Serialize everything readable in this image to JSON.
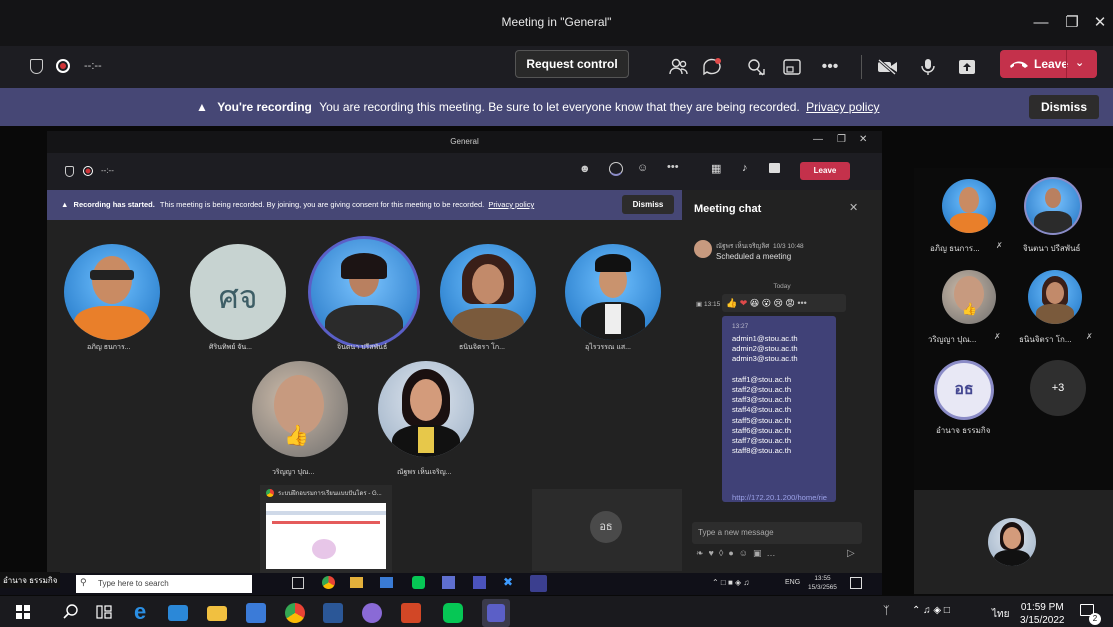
{
  "window": {
    "title": "Meeting in \"General\""
  },
  "toolbar": {
    "timer": "--:--",
    "request_control": "Request control",
    "leave": "Leave"
  },
  "banner": {
    "title": "You're recording",
    "text": "You are recording this meeting. Be sure to let everyone know that they are being recorded.",
    "link": "Privacy policy",
    "dismiss": "Dismiss"
  },
  "inner": {
    "title": "General",
    "timer": "--:--",
    "leave": "Leave",
    "banner": {
      "title": "Recording has started.",
      "text": "This meeting is being recorded. By joining, you are giving consent for this meeting to be recorded.",
      "link": "Privacy policy",
      "dismiss": "Dismiss"
    },
    "participants": [
      "อภิญ ธนการ...",
      "ศิรินทิพย์ จัน...",
      "จินตนา ปรีสพันธ์",
      "ธนินจิตรา โก...",
      "อุไรวรรณ แส...",
      "วริญญา ปุณ...",
      "ณัฐพร เห็นเจริญ..."
    ],
    "initials_tile": "ศจ",
    "share_title": "ระบบฝึกอบรมการเรียนแบบปันโดร - G...",
    "small_tile": "อธ"
  },
  "chat": {
    "title": "Meeting chat",
    "sender": "ณัฐพร เห็นเจริญลิศ",
    "sender_time": "10/3 10:48",
    "system": "Scheduled a meeting",
    "today": "Today",
    "time1": "13:15",
    "msg_time": "13:27",
    "lines": [
      "admin1@stou.ac.th",
      "admin2@stou.ac.th",
      "admin3@stou.ac.th",
      "",
      "staff1@stou.ac.th",
      "staff2@stou.ac.th",
      "staff3@stou.ac.th",
      "staff4@stou.ac.th",
      "staff5@stou.ac.th",
      "staff6@stou.ac.th",
      "staff7@stou.ac.th",
      "staff8@stou.ac.th"
    ],
    "link": "http://172.20.1.200/home/rie",
    "placeholder": "Type a new message"
  },
  "right_panel": {
    "names": [
      "อภิญ ธนการ...",
      "จินตนา ปรีสพันธ์",
      "วริญญา ปุณ...",
      "ธนินจิตรา โก...",
      "อำนาจ ธรรมกิจ"
    ],
    "initials": "อธ",
    "more": "+3"
  },
  "inner_taskbar": {
    "label": "อำนาจ ธรรมกิจ",
    "search": "Type here to search",
    "lang": "ENG",
    "time": "13:55",
    "date": "15/3/2565"
  },
  "taskbar": {
    "lang": "ไทย",
    "time": "01:59 PM",
    "date": "3/15/2022",
    "badge": "2"
  }
}
